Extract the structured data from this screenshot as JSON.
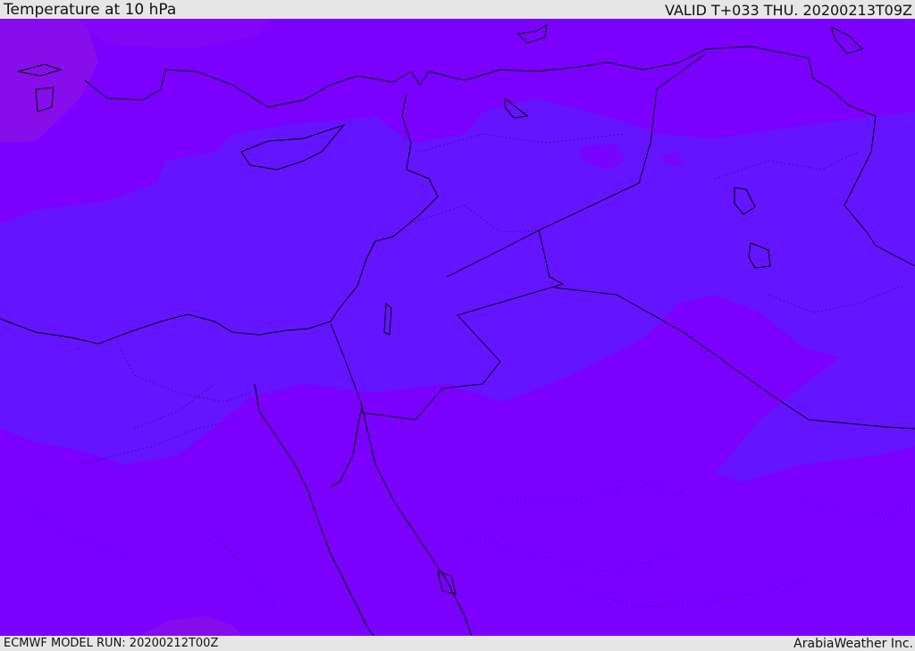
{
  "header": {
    "title": "Temperature at 10 hPa",
    "valid": "VALID T+033 THU. 20200213T09Z"
  },
  "footer": {
    "model_run": "ECMWF MODEL RUN: 20200212T00Z",
    "credit": "ArabiaWeather Inc."
  },
  "map": {
    "region": "Eastern Mediterranean and Middle East",
    "field": "10 hPa temperature (shaded)",
    "colors": {
      "dominant": "#7b00ff",
      "cooler_band": "#6414ff",
      "warmer_patch": "#8a10e6",
      "boundaries": "#000000"
    }
  }
}
